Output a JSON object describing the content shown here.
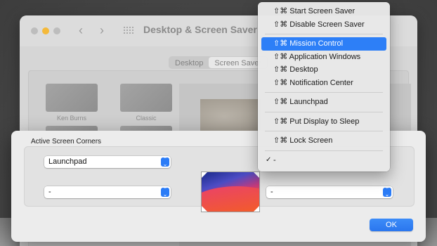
{
  "window": {
    "title": "Desktop & Screen Saver",
    "back_glyph": "‹",
    "forward_glyph": "›"
  },
  "tabs": [
    {
      "label": "Desktop",
      "active": false
    },
    {
      "label": "Screen Saver",
      "active": true
    }
  ],
  "screensavers": [
    {
      "label": "Ken Burns"
    },
    {
      "label": "Classic"
    }
  ],
  "sheet": {
    "title": "Active Screen Corners",
    "top_left": "Launchpad",
    "bottom_left": "-",
    "top_right": "",
    "bottom_right": "-",
    "ok_label": "OK",
    "popup_arrows": "⌃⌄"
  },
  "menu": {
    "items": [
      {
        "label": "⇧⌘ Start Screen Saver",
        "selected": false,
        "checked": false
      },
      {
        "label": "⇧⌘ Disable Screen Saver",
        "selected": false,
        "checked": false
      },
      {
        "separator": true
      },
      {
        "label": "⇧⌘ Mission Control",
        "selected": true,
        "checked": false
      },
      {
        "label": "⇧⌘ Application Windows",
        "selected": false,
        "checked": false
      },
      {
        "label": "⇧⌘ Desktop",
        "selected": false,
        "checked": false
      },
      {
        "label": "⇧⌘ Notification Center",
        "selected": false,
        "checked": false
      },
      {
        "separator": true
      },
      {
        "label": "⇧⌘ Launchpad",
        "selected": false,
        "checked": false
      },
      {
        "separator": true
      },
      {
        "label": "⇧⌘ Put Display to Sleep",
        "selected": false,
        "checked": false
      },
      {
        "separator": true
      },
      {
        "label": "⇧⌘ Lock Screen",
        "selected": false,
        "checked": false
      },
      {
        "separator": true
      },
      {
        "label": "-",
        "selected": false,
        "checked": true
      }
    ],
    "check_glyph": "✓"
  },
  "colors": {
    "accent": "#2d7ff7",
    "minimize_button": "#f4b93a"
  }
}
